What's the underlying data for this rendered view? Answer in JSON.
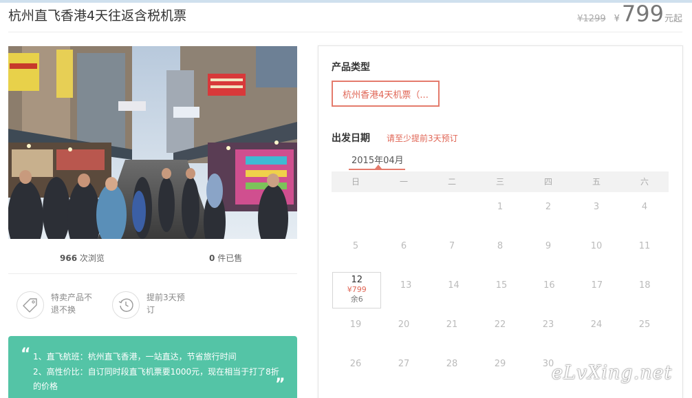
{
  "product": {
    "title": "杭州直飞香港4天往返含税机票",
    "old_price": "¥1299",
    "currency": "¥",
    "price": "799",
    "unit": "元起"
  },
  "stats": {
    "views_count": "966",
    "views_label": "次浏览",
    "sold_count": "0",
    "sold_label": "件已售"
  },
  "features": [
    {
      "icon": "price-tag-icon",
      "text": "特卖产品不退不换"
    },
    {
      "icon": "clock-icon",
      "text": "提前3天预订"
    }
  ],
  "highlights": {
    "quote_open": "“",
    "quote_close": "”",
    "line1": "1、直飞航班：杭州直飞香港，一站直达，节省旅行时间",
    "line2": "2、高性价比：自订同时段直飞机票要1000元，现在相当于打了8折的价格"
  },
  "booking": {
    "product_type_label": "产品类型",
    "product_type_option": "杭州香港4天机票（...",
    "date_label": "出发日期",
    "date_note": "请至少提前3天预订",
    "month": "2015年04月",
    "weekdays": [
      "日",
      "一",
      "二",
      "三",
      "四",
      "五",
      "六"
    ],
    "selected_day": {
      "day": "12",
      "price": "¥799",
      "stock": "余6"
    },
    "rows": [
      [
        "",
        "",
        "",
        "1",
        "2",
        "3",
        "4"
      ],
      [
        "5",
        "6",
        "7",
        "8",
        "9",
        "10",
        "11"
      ],
      [
        "12",
        "13",
        "14",
        "15",
        "16",
        "17",
        "18"
      ],
      [
        "19",
        "20",
        "21",
        "22",
        "23",
        "24",
        "25"
      ],
      [
        "26",
        "27",
        "28",
        "29",
        "30",
        "",
        ""
      ]
    ]
  },
  "watermark": "eLvXing.net",
  "colors": {
    "accent": "#e06656",
    "highlight_bg": "#54c4a6"
  }
}
